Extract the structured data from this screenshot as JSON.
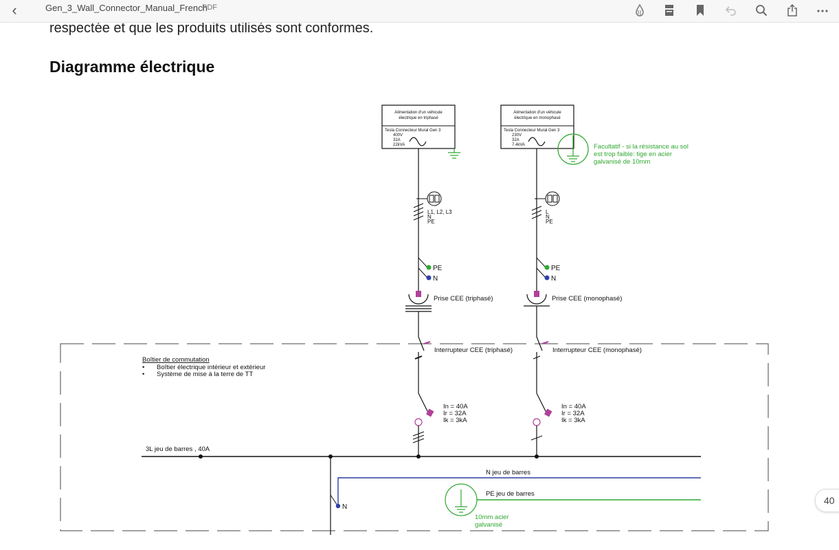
{
  "app": {
    "document_title": "Gen_3_Wall_Connector_Manual_French",
    "document_type": "PDF",
    "page_number": "40"
  },
  "toolbar": {
    "icons": [
      "ink-drop-icon",
      "page-layout-icon",
      "bookmark-icon",
      "undo-icon",
      "search-icon",
      "share-icon",
      "more-icon"
    ]
  },
  "page": {
    "text_line": "respectée et que les produits utilisés sont conformes.",
    "heading": "Diagramme électrique"
  },
  "diagram": {
    "supply_tri": {
      "title_line1": "Alimentation d'un véhicule",
      "title_line2": "électrique en triphasé",
      "device": "Tesla Connecteur Mural Gen 3",
      "v1": "400V",
      "v2": "32A",
      "v3": "22kVA"
    },
    "supply_mono": {
      "title_line1": "Alimentation d'un véhicule",
      "title_line2": "électrique en monophasé",
      "device": "Tesla Connecteur Mural Gen 3",
      "v1": "230V",
      "v2": "32A",
      "v3": "7.4kVA"
    },
    "optional_note": {
      "line1": "Facultatif - si la résistance au sol",
      "line2": "est trop faible: tige en acier",
      "line3": "galvanisé de 10mm"
    },
    "tri_conductors": {
      "line1": "L1, L2, L3",
      "line2": "N",
      "line3": "PE"
    },
    "mono_conductors": {
      "line1": "L",
      "line2": "N",
      "line3": "PE"
    },
    "pe": "PE",
    "n": "N",
    "socket_tri": "Prise CEE (triphasé)",
    "socket_mono": "Prise CEE (monophasé)",
    "switch_tri": "Interrupteur CEE (triphasé)",
    "switch_mono": "Interrupteur CEE (monophasé)",
    "breaker": {
      "in": "In = 40A",
      "ir": "Ir = 32A",
      "ik": "Ik = 3kA"
    },
    "box": {
      "title": "Boîtier de commutation",
      "item1": "Boîtier électrique intérieur et extérieur",
      "item2": "Système de mise à la terre de TT"
    },
    "busbar_3l": "3L jeu de barres , 40A",
    "busbar_n": "N jeu de barres",
    "busbar_pe": "PE jeu de barres",
    "ground_rod": {
      "line1": "10mm acier",
      "line2": "galvanisé"
    },
    "colors": {
      "wire": "#1a1a1a",
      "green": "#2fa830",
      "blue": "#2c3fa8",
      "magenta": "#b0409a"
    }
  }
}
